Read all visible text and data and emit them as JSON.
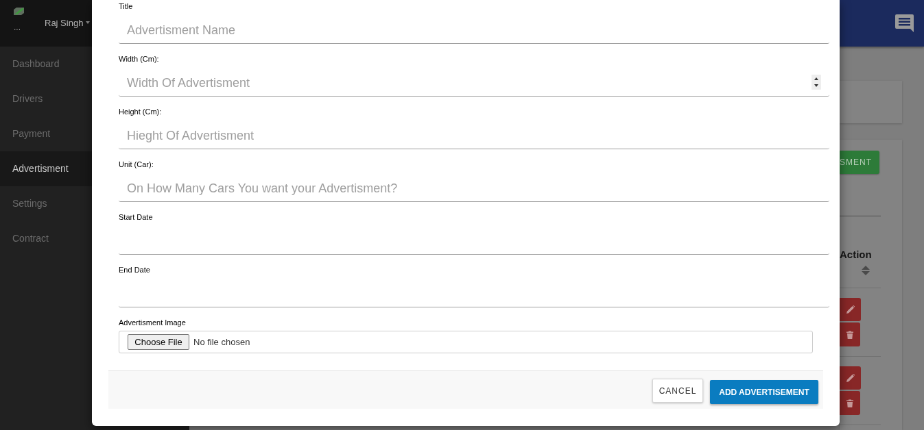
{
  "sidebar": {
    "logo_alt": "...",
    "user": "Raj Singh",
    "items": [
      {
        "label": "Dashboard",
        "selected": false
      },
      {
        "label": "Drivers",
        "selected": false
      },
      {
        "label": "Payment",
        "selected": false
      },
      {
        "label": "Advertisment",
        "selected": true
      },
      {
        "label": "Settings",
        "selected": false
      },
      {
        "label": "Contract",
        "selected": false
      }
    ]
  },
  "page": {
    "button": "SMENT",
    "table": {
      "columns": [
        {
          "label": "Action",
          "sortable": true
        }
      ],
      "rows": [
        {
          "actions": [
            {
              "kind": "edit"
            },
            {
              "kind": "delete"
            }
          ]
        },
        {
          "actions": [
            {
              "kind": "edit"
            },
            {
              "kind": "delete"
            }
          ]
        }
      ]
    }
  },
  "modal": {
    "fields": [
      {
        "label": "Title",
        "kind": "text",
        "placeholder": "Advertisment Name"
      },
      {
        "label": "Width (Cm):",
        "kind": "number",
        "placeholder": "Width Of Advertisment"
      },
      {
        "label": "Height (Cm):",
        "kind": "text",
        "placeholder": "Hieght Of Advertisment"
      },
      {
        "label": "Unit (Car):",
        "kind": "text",
        "placeholder": "On How Many Cars You want your Advertisment?"
      },
      {
        "label": "Start Date",
        "kind": "text"
      },
      {
        "label": "End Date",
        "kind": "text"
      },
      {
        "label": "Advertisment Image",
        "kind": "file",
        "button": "Choose File",
        "status": "No file chosen"
      }
    ],
    "buttons": [
      {
        "label": "CANCEL",
        "kind": "secondary"
      },
      {
        "label": "ADD ADVERTISEMENT",
        "kind": "primary"
      }
    ]
  }
}
